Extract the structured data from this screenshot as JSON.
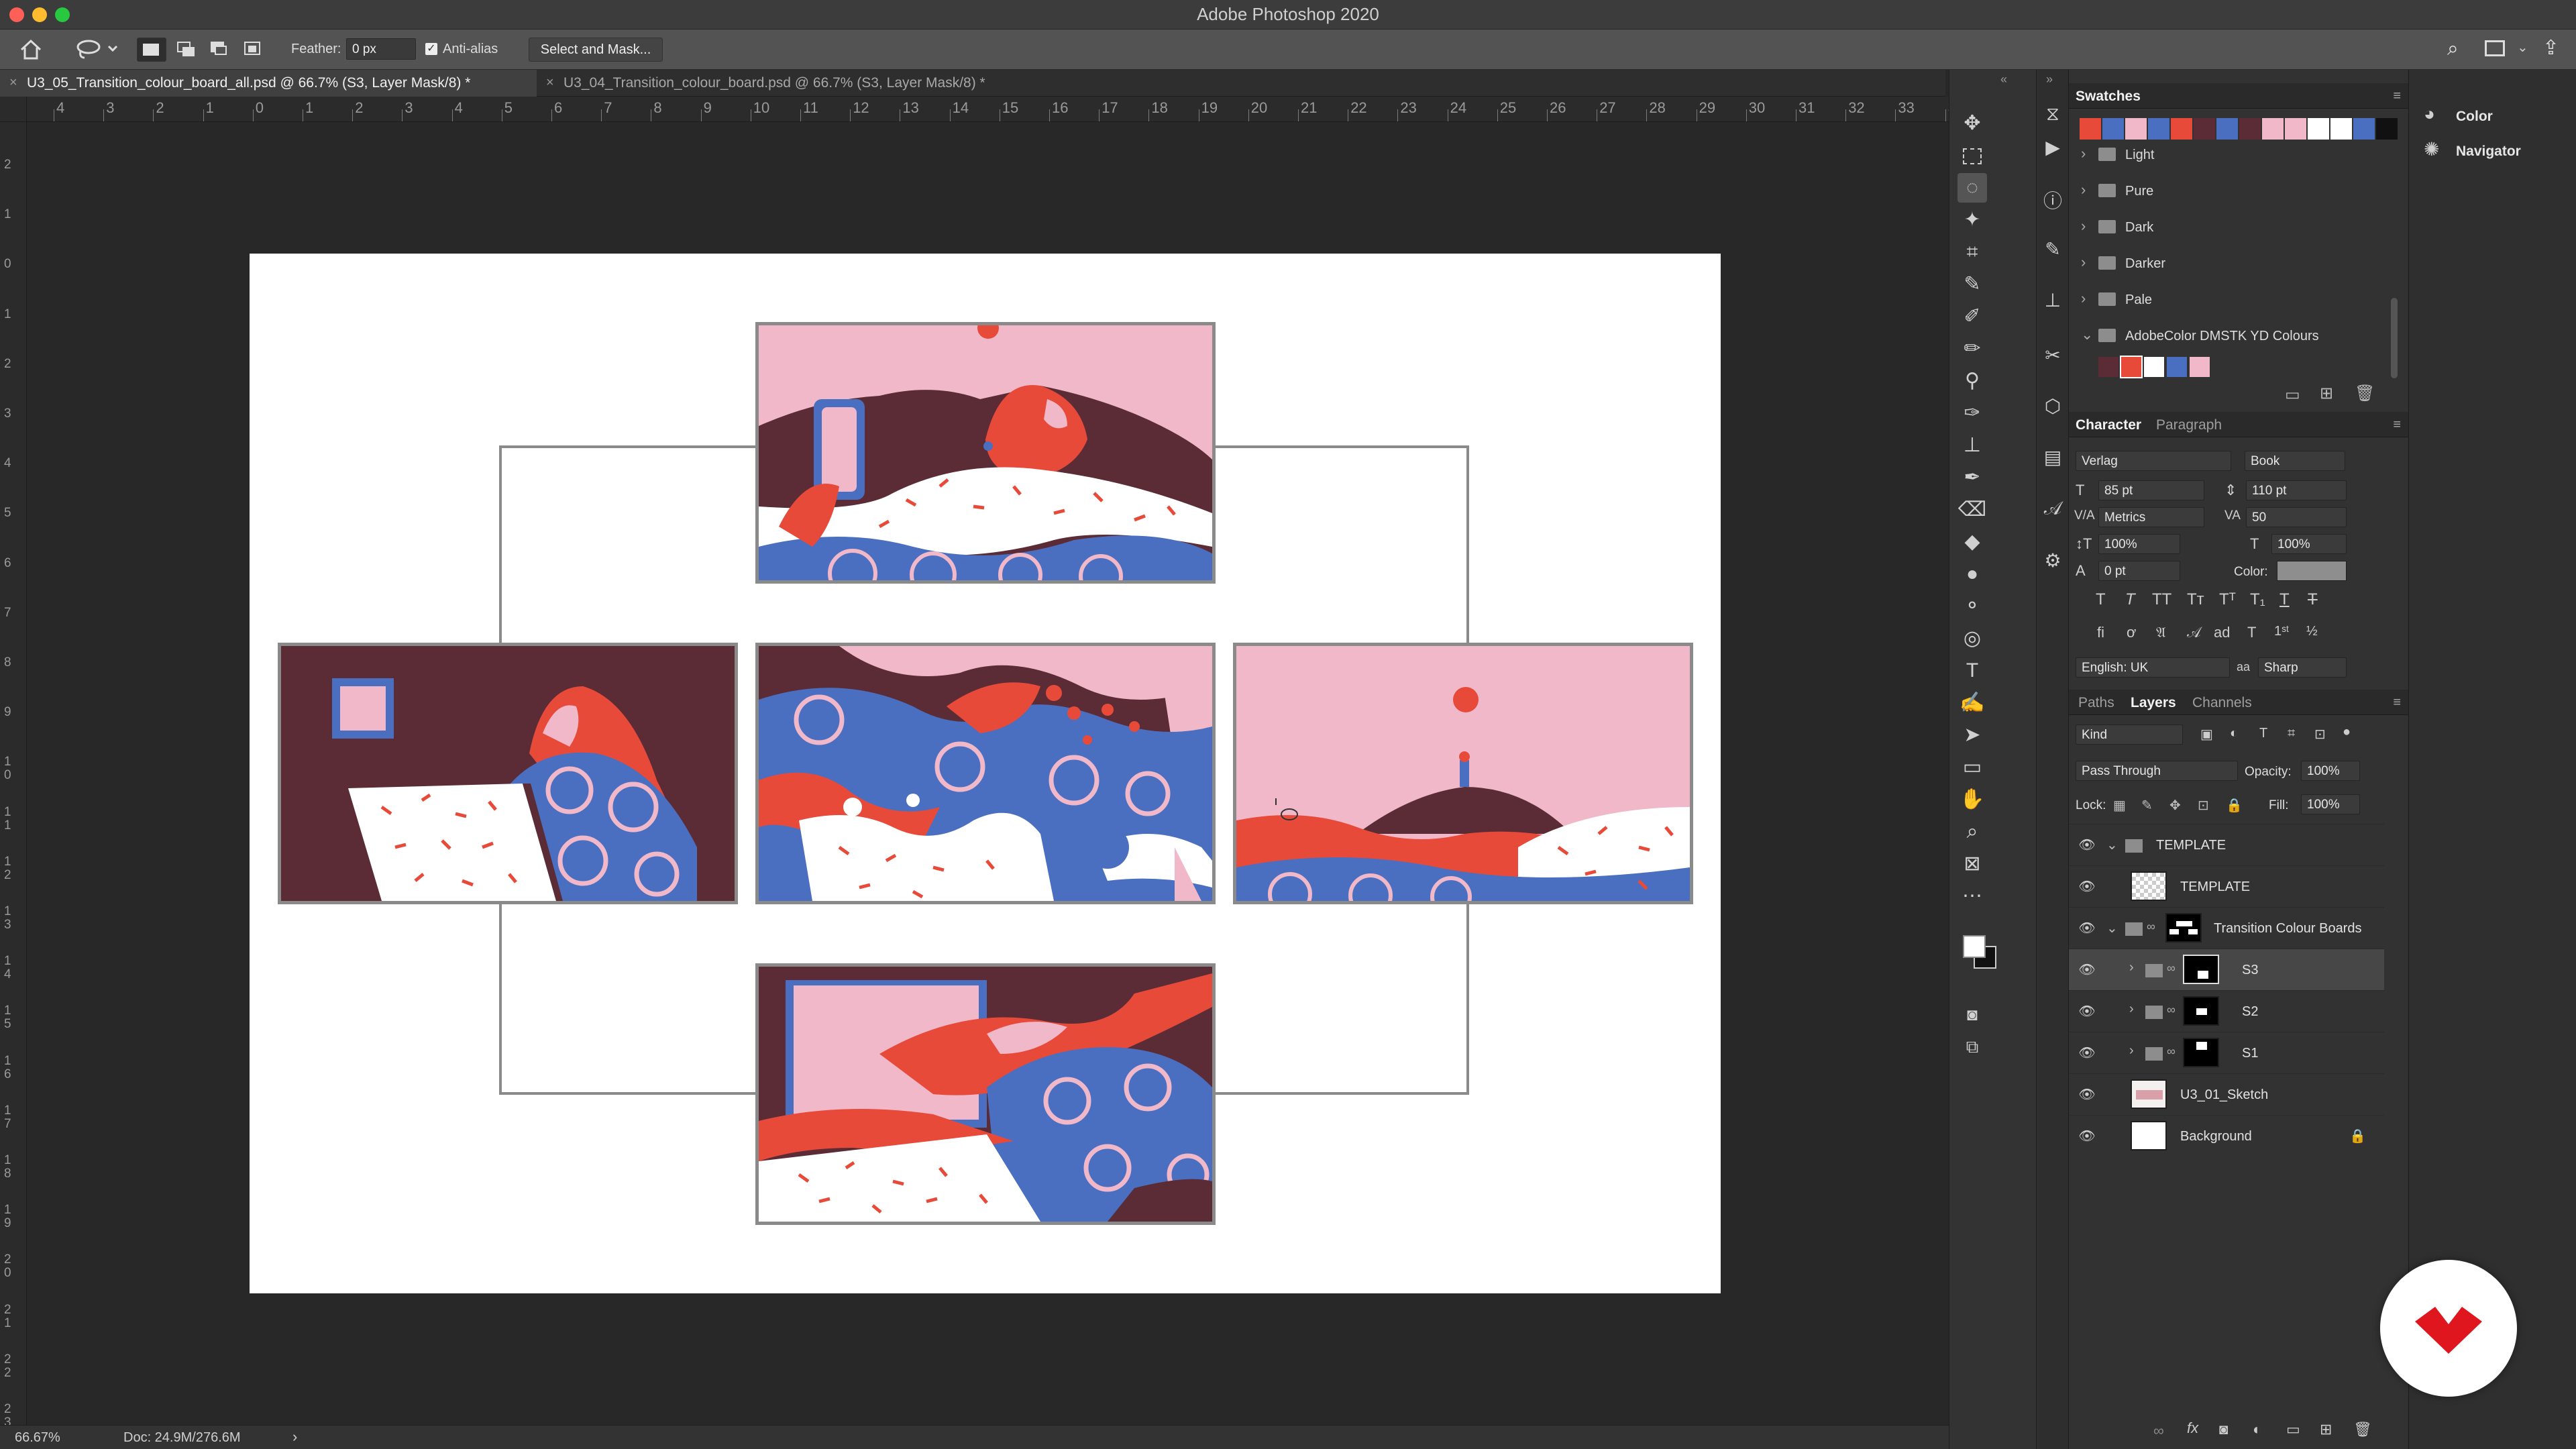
{
  "window": {
    "title": "Adobe Photoshop 2020"
  },
  "options_bar": {
    "feather_label": "Feather:",
    "feather_value": "0 px",
    "antialias_label": "Anti-alias",
    "select_mask_label": "Select and Mask..."
  },
  "tabs": [
    {
      "label": "U3_05_Transition_colour_board_all.psd @ 66.7% (S3, Layer Mask/8) *",
      "close": "×"
    },
    {
      "label": "U3_04_Transition_colour_board.psd @ 66.7% (S3, Layer Mask/8) *",
      "close": "×"
    }
  ],
  "ruler": {
    "h_labels": [
      "4",
      "3",
      "2",
      "1",
      "0",
      "1",
      "2",
      "3",
      "4",
      "5",
      "6",
      "7",
      "8",
      "9",
      "10",
      "11",
      "12",
      "13",
      "14",
      "15",
      "16",
      "17",
      "18",
      "19",
      "20",
      "21",
      "22",
      "23",
      "24",
      "25",
      "26",
      "27",
      "28",
      "29",
      "30",
      "31",
      "32",
      "33",
      "3"
    ],
    "v_labels": [
      "2",
      "1",
      "0",
      "1",
      "2",
      "3",
      "4",
      "5",
      "6",
      "7",
      "8",
      "9",
      "10",
      "11",
      "12",
      "13",
      "14",
      "15",
      "16",
      "17",
      "18",
      "19",
      "20",
      "21",
      "22",
      "23"
    ]
  },
  "status": {
    "zoom": "66.67%",
    "doc": "Doc: 24.9M/276.6M",
    "arrow": "›"
  },
  "swatches_panel": {
    "title": "Swatches",
    "colors": [
      "#e84a3a",
      "#4a6fc0",
      "#f0b8c8",
      "#4a6fc0",
      "#e84a3a",
      "#5b2c35",
      "#4a6fc0",
      "#5b2c35",
      "#f0b8c8",
      "#f0b8c8",
      "#ffffff",
      "#ffffff",
      "#4a6fc0",
      "#111111"
    ],
    "folders": [
      "Light",
      "Pure",
      "Dark",
      "Darker",
      "Pale",
      "AdobeColor DMSTK YD Colours"
    ],
    "group_colors": [
      "#5b2c35",
      "#e84a3a",
      "#ffffff",
      "#4a6fc0",
      "#f0b8c8"
    ]
  },
  "character_panel": {
    "tab_active": "Character",
    "tab_inactive": "Paragraph",
    "font_family": "Verlag",
    "font_style": "Book",
    "size": "85 pt",
    "leading": "110 pt",
    "kerning": "Metrics",
    "tracking": "50",
    "vscale": "100%",
    "hscale": "100%",
    "baseline": "0 pt",
    "color_label": "Color:",
    "language": "English: UK",
    "aa_label": "aa",
    "antialias": "Sharp"
  },
  "layers_panel": {
    "tab_paths": "Paths",
    "tab_layers": "Layers",
    "tab_channels": "Channels",
    "kind": "Kind",
    "blend_mode": "Pass Through",
    "opacity_label": "Opacity:",
    "opacity": "100%",
    "lock_label": "Lock:",
    "fill_label": "Fill:",
    "fill": "100%",
    "layers": [
      {
        "name": "TEMPLATE",
        "type": "group"
      },
      {
        "name": "TEMPLATE",
        "type": "layer"
      },
      {
        "name": "Transition Colour Boards",
        "type": "group"
      },
      {
        "name": "S3",
        "type": "group",
        "selected": true
      },
      {
        "name": "S2",
        "type": "group"
      },
      {
        "name": "S1",
        "type": "group"
      },
      {
        "name": "U3_01_Sketch",
        "type": "layer"
      },
      {
        "name": "Background",
        "type": "layer"
      }
    ]
  },
  "far_panel": {
    "color_label": "Color",
    "navigator_label": "Navigator"
  },
  "palette": {
    "pink": "#f1b8c9",
    "maroon": "#5b2c35",
    "red": "#e84a3a",
    "blue": "#4a6fc0",
    "white": "#ffffff"
  }
}
